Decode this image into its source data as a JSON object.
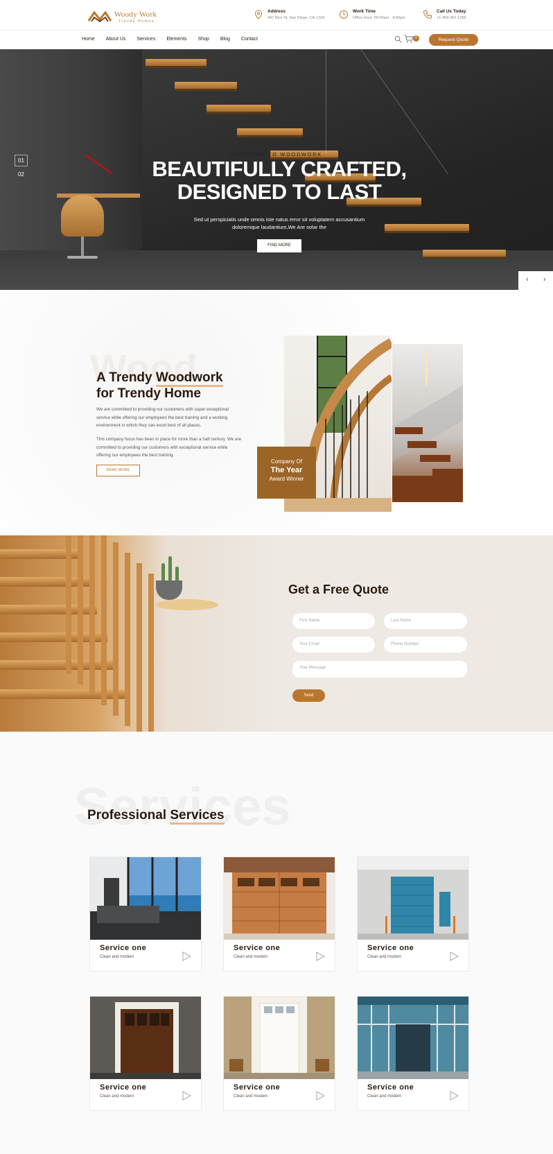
{
  "header": {
    "logo_name": "Woody Work",
    "logo_tagline": "Trendy Homes",
    "address_title": "Address",
    "address_value": "347 Nice St, San Diego, CA, USA",
    "worktime_title": "Work Time",
    "worktime_value": "Office Hour: 09:00am - 4:00pm",
    "call_title": "Call Us Today",
    "call_value": "+1-458-362-1258",
    "accent_color": "#b9772e"
  },
  "nav": {
    "items": [
      "Home",
      "About Us",
      "Services",
      "Elements",
      "Shop",
      "Blog",
      "Contact"
    ],
    "cart_count": "0",
    "quote_label": "Request Quote",
    "icons": [
      "search-icon",
      "cart-icon"
    ]
  },
  "hero": {
    "slide_1": "01",
    "slide_2": "02",
    "kicker": "WELCOME TO WOODWORK",
    "title_line1": "BEAUTIFULLY CRAFTED,",
    "title_line2": "DESIGNED TO LAST",
    "subtitle": "Sed ut perspiciatis unde omnis iste natus error sit voluptatem accusantium doloremque laudantium,We Are solar the",
    "button": "FIND MORE",
    "prev": "‹",
    "next": "›"
  },
  "about": {
    "ghost_word": "Wood",
    "title_line1_a": "A Trendy ",
    "title_line1_b": "Woodwork",
    "title_line2": "for Trendy Home",
    "para1": "We are committed to providing our customers with super exceptional service while offering our employees the best training and a working environment in which they can excel best of all places.",
    "para2": "This company focus has been in place for more than a half century. We are committed to providing our customers with exceptional service while offering our employees the best training.",
    "button": "READ MORE",
    "award_line1": "Company Of",
    "award_line2": "The Year",
    "award_line3": "Award Winner"
  },
  "quote": {
    "title": "Get a Free Quote",
    "first_name": "First Name",
    "last_name": "Last Name",
    "email": "Your Email",
    "phone": "Phone Number",
    "message": "Your Message",
    "send": "Send"
  },
  "services": {
    "ghost_word": "Services",
    "title_a": "Professional ",
    "title_b": "Services",
    "cards": [
      {
        "title": "Service one",
        "subtitle": "Clean and modern"
      },
      {
        "title": "Service one",
        "subtitle": "Clean and modern"
      },
      {
        "title": "Service one",
        "subtitle": "Clean and modern"
      },
      {
        "title": "Service one",
        "subtitle": "Clean and modern"
      },
      {
        "title": "Service one",
        "subtitle": "Clean and modern"
      },
      {
        "title": "Service one",
        "subtitle": "Clean and modern"
      }
    ]
  }
}
